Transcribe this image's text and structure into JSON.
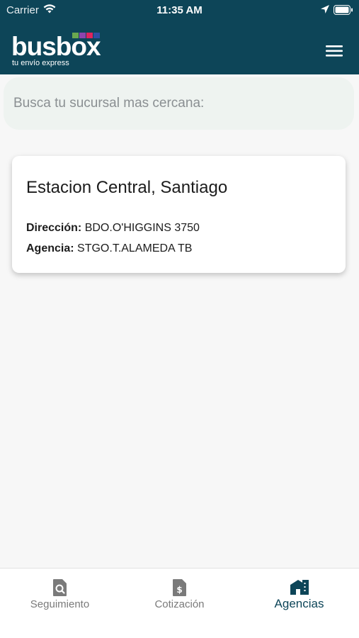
{
  "status_bar": {
    "carrier": "Carrier",
    "time": "11:35 AM",
    "icons": [
      "wifi-icon",
      "location-icon",
      "battery-icon"
    ]
  },
  "app_bar": {
    "logo": {
      "wordmark": "busbox",
      "tagline": "tu envío express",
      "square_colors": [
        "#6aa84f",
        "#8e44ad",
        "#e0245e",
        "#2e4fa3"
      ]
    },
    "menu_icon": "hamburger-menu-icon"
  },
  "search": {
    "placeholder": "Busca tu sucursal mas cercana:"
  },
  "agencies": [
    {
      "title": "Estacion Central, Santiago",
      "address_label": "Dirección:",
      "address_value": "BDO.O'HIGGINS 3750",
      "agency_label": "Agencia:",
      "agency_value": "STGO.T.ALAMEDA TB"
    }
  ],
  "tab_bar": {
    "tabs": [
      {
        "label": "Seguimiento",
        "icon": "document-search-icon",
        "active": false
      },
      {
        "label": "Cotización",
        "icon": "document-dollar-icon",
        "active": false
      },
      {
        "label": "Agencias",
        "icon": "building-icon",
        "active": true
      }
    ]
  },
  "colors": {
    "brand_dark": "#0d4558",
    "background": "#f7f7f7",
    "search_background": "#eef3f0",
    "inactive_tab": "#7a7a7a"
  }
}
